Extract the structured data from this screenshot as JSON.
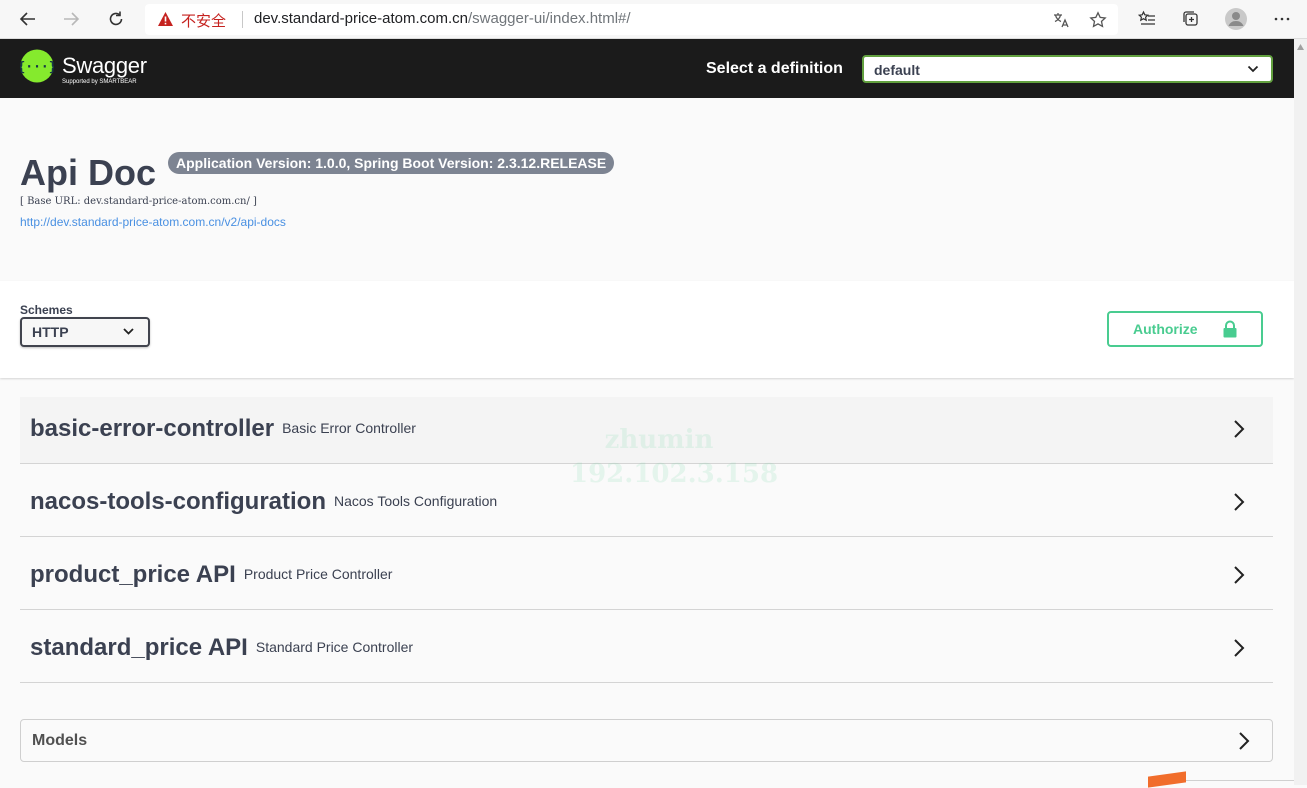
{
  "browser": {
    "insecure_label": "不安全",
    "url_host": "dev.standard-price-atom.com.cn",
    "url_path": "/swagger-ui/index.html#/"
  },
  "topbar": {
    "logo_text": "Swagger",
    "logo_subtext": "Supported by SMARTBEAR",
    "definition_label": "Select a definition",
    "definition_value": "default"
  },
  "info": {
    "title": "Api Doc",
    "version": "Application Version: 1.0.0, Spring Boot Version: 2.3.12.RELEASE",
    "base_url": "[ Base URL: dev.standard-price-atom.com.cn/ ]",
    "api_docs_link": "http://dev.standard-price-atom.com.cn/v2/api-docs"
  },
  "schemes": {
    "label": "Schemes",
    "value": "HTTP"
  },
  "authorize_label": "Authorize",
  "tags": [
    {
      "name": "basic-error-controller",
      "description": "Basic Error Controller"
    },
    {
      "name": "nacos-tools-configuration",
      "description": "Nacos Tools Configuration"
    },
    {
      "name": "product_price API",
      "description": "Product Price Controller"
    },
    {
      "name": "standard_price API",
      "description": "Standard Price Controller"
    }
  ],
  "models_label": "Models",
  "watermark": {
    "user": "zhumin",
    "ip": "192.102.3.158"
  },
  "colors": {
    "accent_green": "#49cc90",
    "topbar_bg": "#1b1b1b",
    "link_blue": "#4990e2",
    "badge_gray": "#7d8492"
  }
}
